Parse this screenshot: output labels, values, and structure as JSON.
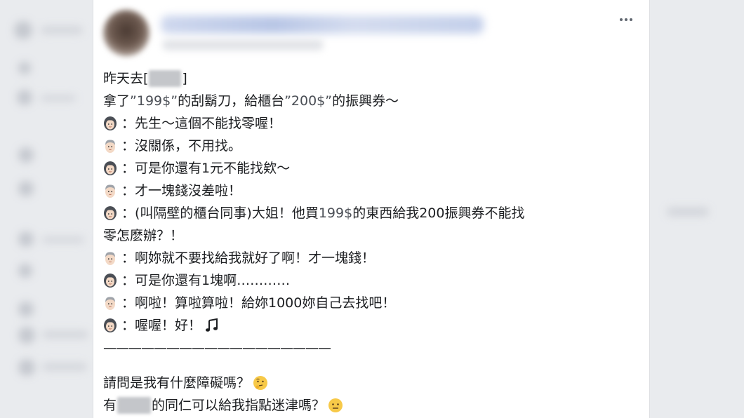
{
  "post": {
    "lines": [
      {
        "type": "plain",
        "before": "昨天去[",
        "after": "]"
      },
      {
        "type": "plain",
        "text_a": "拿了",
        "text_b": "”199$”",
        "text_c": "的刮鬍刀，給櫃台",
        "text_d": "”200$”",
        "text_e": "的振興券～"
      },
      {
        "type": "dialog",
        "speaker": "woman",
        "text": "：先生～這個不能找零喔！"
      },
      {
        "type": "dialog",
        "speaker": "man",
        "text": "：沒關係，不用找。"
      },
      {
        "type": "dialog",
        "speaker": "woman",
        "text": "：可是你還有1元不能找欸～"
      },
      {
        "type": "dialog",
        "speaker": "man",
        "text": "：才一塊錢沒差啦！"
      },
      {
        "type": "dialog",
        "speaker": "woman",
        "text_a": "：(叫隔壁的櫃台同事)大姐！他買",
        "text_b": "199$",
        "text_c": "的東西給我200振興券不能找",
        "text_d": "零怎麽辦？！"
      },
      {
        "type": "dialog",
        "speaker": "man",
        "text": "：啊妳就不要找給我就好了啊！才一塊錢！"
      },
      {
        "type": "dialog",
        "speaker": "woman",
        "text": "：可是你還有1塊啊…………"
      },
      {
        "type": "dialog",
        "speaker": "man",
        "text": "：啊啦！算啦算啦！給妳1000妳自己去找吧！"
      },
      {
        "type": "dialog",
        "speaker": "woman",
        "text": "：喔喔！好！",
        "emoji": "music-note"
      }
    ],
    "divider": "——————————————————",
    "question_1": "請問是我有什麼障礙嗎？",
    "question_2_before": "有",
    "question_2_after": "的同仁可以給我指點迷津嗎？"
  },
  "icons": {
    "woman": "woman-face-icon",
    "man": "man-face-icon",
    "music": "music-note-icon",
    "thinking": "thinking-face-icon",
    "neutral": "neutral-face-icon",
    "more": "more-options-icon"
  },
  "colors": {
    "background": "#e9ebee",
    "card": "#ffffff",
    "text": "#1c1e21",
    "gray_text": "#4b4f56"
  }
}
